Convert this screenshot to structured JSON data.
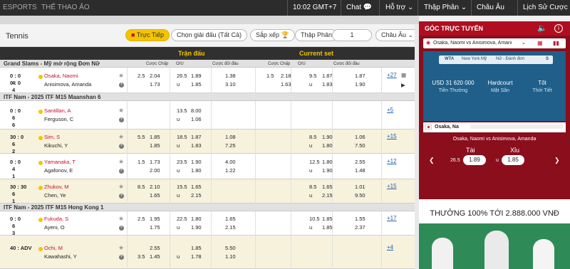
{
  "topbar": {
    "esports": "ESPORTS",
    "virtual": "THỂ THAO ẢO",
    "time": "10:02 GMT+7",
    "chat": "Chat",
    "support": "Hỗ trợ",
    "odds": "Thập Phân",
    "lang": "Châu Âu",
    "history": "Lịch Sử Cược"
  },
  "sport": {
    "title": "Tennis",
    "live": "Trực Tiếp",
    "choose": "Chọn giải đấu (Tất Cả)",
    "sort": "Sắp xếp",
    "odds": "Thập Phân",
    "page": "1",
    "region": "Châu Âu"
  },
  "headers": {
    "match": "Trận đấu",
    "current": "Current set",
    "hc": "Cược Chấp",
    "ou": "O/U",
    "win": "Cược đối đầu"
  },
  "leagues": [
    {
      "name": "Grand Slams - Mỹ mở rộng Đơn Nữ",
      "sub": ""
    },
    {
      "name": "ITF Nam - 2025 ITF M15 Maanshan 6",
      "sub": ""
    },
    {
      "name": "ITF Nam - 2025 ITF M15 Hong Kong 1",
      "sub": ""
    }
  ],
  "matches": [
    {
      "s1": "0 : 0",
      "s2": "0 : 0",
      "g": [
        "4",
        "4"
      ],
      "p1": "Osaka, Naomi",
      "p2": "Anisimova, Amanda",
      "hcl": [
        "2.5",
        ""
      ],
      "hc": [
        "2.04",
        "1.73"
      ],
      "oul": [
        "26.5",
        "u"
      ],
      "ou": [
        "1.89",
        "1.85"
      ],
      "w": [
        "1.38",
        "3.10"
      ],
      "chcl": [
        "1.5",
        ""
      ],
      "chc": [
        "2.18",
        "1.63"
      ],
      "coul": [
        "9.5",
        "u"
      ],
      "cou": [
        "1.87",
        "1.83"
      ],
      "cw": [
        "1.87",
        "1.90"
      ],
      "more": "+27"
    },
    {
      "s1": "0 : 0",
      "s2": "",
      "g": [
        "6",
        "6"
      ],
      "p1": "Santillan, A",
      "p2": "Ferguson, C",
      "hcl": [
        "",
        ""
      ],
      "hc": [
        "",
        ""
      ],
      "oul": [
        "13.5",
        "u"
      ],
      "ou": [
        "8.00",
        "1.06"
      ],
      "w": [
        "",
        ""
      ],
      "chcl": [
        "",
        ""
      ],
      "chc": [
        "",
        ""
      ],
      "coul": [
        "",
        ""
      ],
      "cou": [
        "",
        ""
      ],
      "cw": [
        "",
        ""
      ],
      "more": "+5"
    },
    {
      "s1": "30 : 0",
      "s2": "",
      "g": [
        "6",
        "2"
      ],
      "p1": "Sim, S",
      "p2": "Kikuchi, Y",
      "hcl": [
        "5.5",
        ""
      ],
      "hc": [
        "1.85",
        "1.85"
      ],
      "oul": [
        "18.5",
        "u"
      ],
      "ou": [
        "1.87",
        "1.83"
      ],
      "w": [
        "1.08",
        "7.25"
      ],
      "chcl": [
        "",
        ""
      ],
      "chc": [
        "",
        ""
      ],
      "coul": [
        "8.5",
        "u"
      ],
      "cou": [
        "1.90",
        "1.80"
      ],
      "cw": [
        "1.06",
        "7.50"
      ],
      "more": "+15"
    },
    {
      "s1": "0 : 0",
      "s2": "",
      "g": [
        "4",
        "1"
      ],
      "p1": "Yamanaka, T",
      "p2": "Agafonov, E",
      "hcl": [
        "1.5",
        ""
      ],
      "hc": [
        "1.73",
        "2.00"
      ],
      "oul": [
        "23.5",
        "u"
      ],
      "ou": [
        "1.90",
        "1.80"
      ],
      "w": [
        "4.00",
        "1.22"
      ],
      "chcl": [
        "",
        ""
      ],
      "chc": [
        "",
        ""
      ],
      "coul": [
        "12.5",
        "u"
      ],
      "cou": [
        "1.80",
        "1.90"
      ],
      "cw": [
        "2.55",
        "1.48"
      ],
      "more": "+12"
    },
    {
      "s1": "30 : 30",
      "s2": "",
      "g": [
        "6",
        "1"
      ],
      "p1": "Zhukov, M",
      "p2": "Chen, Ye",
      "hcl": [
        "8.5",
        ""
      ],
      "hc": [
        "2.10",
        "1.65"
      ],
      "oul": [
        "15.5",
        "u"
      ],
      "ou": [
        "1.65",
        "2.15"
      ],
      "w": [
        "",
        ""
      ],
      "chcl": [
        "",
        ""
      ],
      "chc": [
        "",
        ""
      ],
      "coul": [
        "8.5",
        "u"
      ],
      "cou": [
        "1.65",
        "2.15"
      ],
      "cw": [
        "1.01",
        "9.50"
      ],
      "more": "+15"
    },
    {
      "s1": "0 : 0",
      "s2": "",
      "g": [
        "6",
        "3"
      ],
      "p1": "Fukuda, S",
      "p2": "Ayeni, O",
      "hcl": [
        "2.5",
        ""
      ],
      "hc": [
        "1.95",
        "1.75"
      ],
      "oul": [
        "22.5",
        "u"
      ],
      "ou": [
        "1.80",
        "1.90"
      ],
      "w": [
        "1.65",
        "2.15"
      ],
      "chcl": [
        "",
        ""
      ],
      "chc": [
        "",
        ""
      ],
      "coul": [
        "10.5",
        "u"
      ],
      "cou": [
        "1.85",
        "1.85"
      ],
      "cw": [
        "1.55",
        "2.37"
      ],
      "more": "+17"
    },
    {
      "s1": "40 : ADV",
      "s2": "",
      "g": [
        "",
        ""
      ],
      "p1": "Ochi, M",
      "p2": "Kawahashi, Y",
      "hcl": [
        "",
        "3.5"
      ],
      "hc": [
        "2.55",
        "1.45"
      ],
      "oul": [
        "",
        "u"
      ],
      "ou": [
        "1.85",
        "1.78"
      ],
      "w": [
        "5.50",
        "1.10"
      ],
      "chcl": [
        "",
        ""
      ],
      "chc": [
        "",
        ""
      ],
      "coul": [
        "",
        ""
      ],
      "cou": [
        "",
        ""
      ],
      "cw": [
        "",
        ""
      ],
      "more": "+4"
    }
  ],
  "right": {
    "title": "GÓC TRỰC TUYẾN",
    "match": "Osaka, Naomi vs Anisimova, Amanda",
    "tabs": [
      "WTA",
      "New York Mỹ",
      "Nữ - Đánh đơn",
      "S"
    ],
    "prize": "USD 31 620 000",
    "prize_l": "Tiền Thưởng",
    "surface": "Hardcourt",
    "surface_l": "Mặt Sân",
    "weather": "Tốt",
    "weather_l": "Thời Tiết",
    "live_name": "Osaka, Na",
    "fixture": "Osaka, Naomi vs Anisimova, Amanda",
    "tai": "Tài",
    "xiu": "Xỉu",
    "line": "26.5",
    "over": "1.89",
    "under": "1.85",
    "banner": "THƯỞNG 100% TỚI 2.888.000 VNĐ"
  }
}
